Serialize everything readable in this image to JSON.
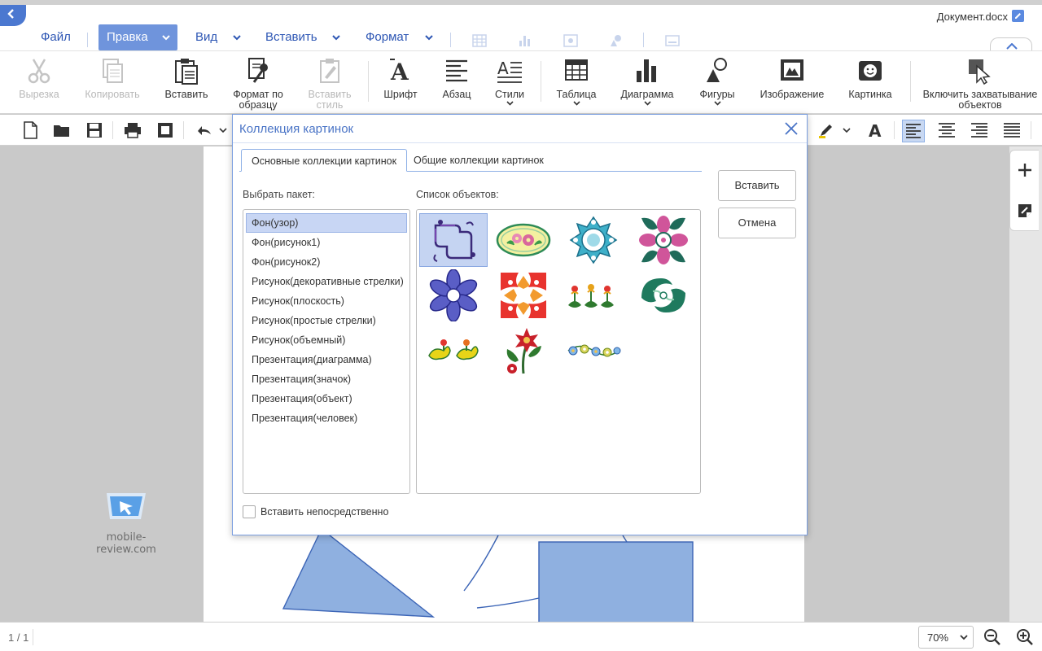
{
  "document": {
    "title": "Документ.docx"
  },
  "menu": {
    "file": "Файл",
    "edit": "Правка",
    "view": "Вид",
    "insert": "Вставить",
    "format": "Формат"
  },
  "ribbon": {
    "cut": "Вырезка",
    "copy": "Копировать",
    "paste": "Вставить",
    "format_painter": "Формат по образцу",
    "paste_style": "Вставить стиль",
    "font": "Шрифт",
    "paragraph": "Абзац",
    "styles": "Стили",
    "table": "Таблица",
    "chart": "Диаграмма",
    "shapes": "Фигуры",
    "image": "Изображение",
    "clipart": "Картинка",
    "object_capture": "Включить захватывание объектов"
  },
  "dialog": {
    "title": "Коллекция картинок",
    "tabs": [
      "Основные коллекции картинок",
      "Общие коллекции картинок"
    ],
    "package_label": "Выбрать пакет:",
    "objects_label": "Список объектов:",
    "packages": [
      "Фон(узор)",
      "Фон(рисунок1)",
      "Фон(рисунок2)",
      "Рисунок(декоративные стрелки)",
      "Рисунок(плоскость)",
      "Рисунок(простые стрелки)",
      "Рисунок(объемный)",
      "Презентация(диаграмма)",
      "Презентация(значок)",
      "Презентация(объект)",
      "Презентация(человек)"
    ],
    "selected_package": "Фон(узор)",
    "insert_button": "Вставить",
    "cancel_button": "Отмена",
    "insert_directly_label": "Вставить непосредственно",
    "insert_directly_checked": false,
    "objects": [
      "corner-ornament",
      "flower-oval",
      "blue-ornament",
      "pink-flower-ornament",
      "purple-flower",
      "red-tile-ornament",
      "green-sprout-border",
      "green-swirl",
      "yellow-birds",
      "red-flower-sprig",
      "flower-chain"
    ]
  },
  "statusbar": {
    "page": "1 / 1",
    "zoom": "70%"
  },
  "watermark": "mobile-review.com",
  "colors": {
    "accent": "#4b78d0",
    "menu_active": "#6f94dc",
    "shape_fill": "#8fb0e0"
  }
}
